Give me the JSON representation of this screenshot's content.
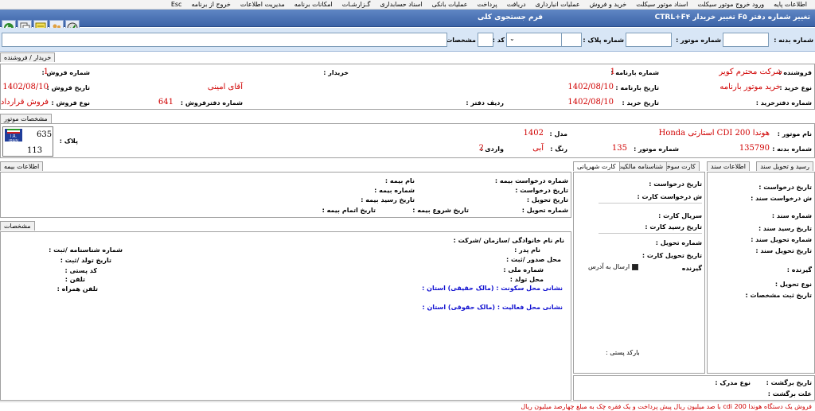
{
  "menu": [
    "اطلاعات پایه",
    "ورود خروج موتور سیکلت",
    "اسناد موتور سیکلت",
    "خرید و فروش",
    "عملیات انبارداری",
    "دریافت",
    "پرداخت",
    "عملیات بانکی",
    "اسناد حسابداری",
    "گـزارشـات",
    "امکانات برنامه",
    "مدیریت اطلاعات",
    "خروج از برنامه",
    "Esc"
  ],
  "title": {
    "right": "تغییر شماره دفتر F۵  تغییر خریدار  CTRL+F۴",
    "center": "فرم جستجوی کلی"
  },
  "search": {
    "body_no": "شماره بدنه :",
    "engine_no": "شماره موتور :",
    "plate_no": "شماره پلاک :",
    "code": "کد :",
    "specs": "مشخصات :"
  },
  "breadcrumb": {
    "tab1": "خریدار",
    "sep": "/",
    "tab2": "فروشنده"
  },
  "sale": {
    "seller_label": "فروشنده :",
    "seller": "شرکت محترم کویر",
    "buy_type_label": "نوع خرید :",
    "buy_type": "خرید موتور بارنامه",
    "book_no_label": "شماره دفترخرید :",
    "waybill_no_label": "شماره بارنامه :",
    "waybill_no": "1",
    "waybill_date_label": "تاریخ بارنامه :",
    "waybill_date": "1402/08/10",
    "buy_date_label": "تاریخ خرید :",
    "buy_date": "1402/08/10",
    "row_label": "ردیف دفتر :",
    "buyer_label": "خریدار :",
    "buyer": "آقای امینی",
    "sale_book_label": "شماره دفترفروش :",
    "sale_book": "641",
    "sale_no_label": "شماره فروش :",
    "sale_no": "1",
    "sale_date_label": "تاریخ فروش :",
    "sale_date": "1402/08/10",
    "sale_type_label": "نوع فروش :",
    "sale_type": "فروش قرارداد"
  },
  "engine_tab": "مشخصات موتور",
  "engine": {
    "name_label": "نام موتور :",
    "name": "هوندا CDI 200 استارتی  Honda",
    "model_label": "مدل :",
    "model": "1402",
    "body_label": "شماره بدنه :",
    "body": "135790",
    "engine_label": "شماره موتور :",
    "engine": "135",
    "color_label": "رنگ :",
    "color": "آبی",
    "import_label": "واردی :",
    "import": "2",
    "plate_label": "پلاک :",
    "plate_top": "635",
    "plate_bottom": "113",
    "plate_flag": "I.R. IRAN"
  },
  "tabs_mid": [
    "رسید و تحویل سند",
    "اطلاعات سند",
    "کارت سوخت",
    "شناسنامه مالکیت",
    "کارت شهرپانی"
  ],
  "doc": {
    "req_date": "تاریخ درخواست :",
    "req_doc": "ش درخواست سند :",
    "doc_no": "شماره سند :",
    "doc_recv": "تاریخ رسید سند :",
    "deliv_no": "شماره تحویل سند :",
    "deliv_date": "تاریخ تحویل سند :",
    "receiver": "گیرنده :",
    "deliv_type": "نوع تحویل :",
    "spec_date": "تاریخ ثبت مشخصات :"
  },
  "fuel": {
    "req_date": "تاریخ درخواست :",
    "req_card": "ش درخواست کارت :",
    "serial": "سریال کارت :",
    "card_recv": "تاریخ رسید کارت :",
    "deliv_no": "شماره تحویل :",
    "deliv_date": "تاریخ تحویل کارت :",
    "receiver": "گیرنده",
    "send_addr": "ارسال به آدرس",
    "barcode": "بارکد پستی :"
  },
  "return": {
    "date": "تاریخ برگشت :",
    "cause": "علت برگشت :",
    "doc_type": "نوع مدرک :"
  },
  "insurance_tab": "اطلاعات بیمه",
  "ins": {
    "req_no": "شماره درخواست بیمه :",
    "name": "نام بیمه :",
    "req_date": "تاریخ درخواست :",
    "ins_no": "شماره بیمه :",
    "deliv_date": "تاریخ تحویل :",
    "recv_date": "تاریخ رسید بیمه :",
    "deliv_no": "شماره تحویل :",
    "start_date": "تاریخ شروع بیمه :",
    "end_date": "تاریخ اتمام بیمه :"
  },
  "specs_tab": "مشخصات",
  "owner": {
    "name": "نام نام خانوادگی /سازمان /شرکت :",
    "father": "نام پدر :",
    "issue": "محل صدور /ثبت :",
    "id_no": "شماره شناسنامه /ثبت :",
    "birth_date": "تاریخ تولد /ثبت :",
    "national": "شماره ملی :",
    "postal": "کد پستی :",
    "birth_place": "محل تولد :",
    "phone": "تلفن :",
    "mobile": "تلفن همراه :",
    "home_addr": "نشانی محل سکونت : (مالک حقیقی) استان :",
    "work_addr": "نشانی محل فعالیت : (مالک حقوقی) استان :"
  },
  "status": "فروش یک دستگاه هوندا 200 cdi با صد میلیون ریال پیش پرداخت و یک فقره چک به مبلغ چهارصد میلیون ریال",
  "colors": {
    "title": "#3c64a8",
    "search_bg": "#d8e6f6",
    "red": "#d00000",
    "blue": "#1010d0"
  }
}
